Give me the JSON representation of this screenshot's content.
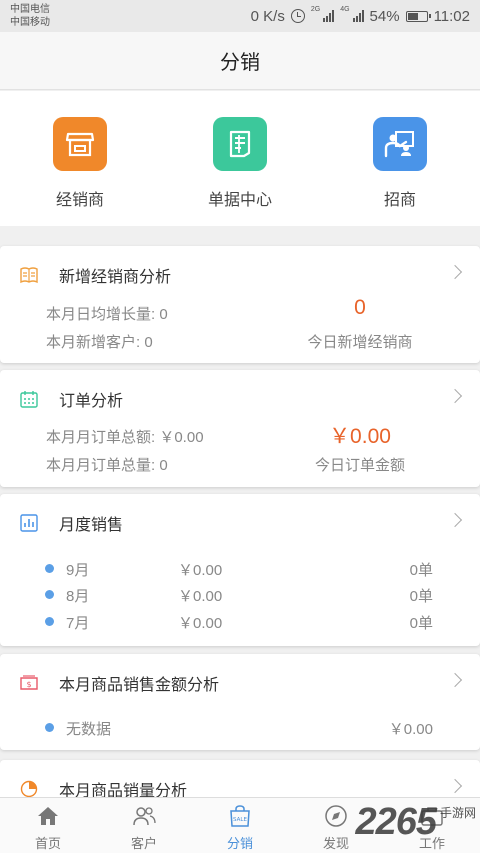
{
  "status_bar": {
    "carrier_1": "中国电信",
    "carrier_2": "中国移动",
    "net_speed": "0 K/s",
    "signal_tag_1": "2G",
    "signal_tag_2": "4G",
    "battery": "54%",
    "time": "11:02"
  },
  "header": {
    "title": "分销"
  },
  "quick_actions": [
    {
      "label": "经销商",
      "icon": "store-icon",
      "color": "#f0882a"
    },
    {
      "label": "单据中心",
      "icon": "receipt-icon",
      "color": "#3cc89b"
    },
    {
      "label": "招商",
      "icon": "recruit-icon",
      "color": "#4a94e8"
    }
  ],
  "cards": {
    "dealer": {
      "title": "新增经销商分析",
      "avg_label": "本月日均增长量: 0",
      "new_clients_label": "本月新增客户: 0",
      "today_value": "0",
      "today_caption": "今日新增经销商"
    },
    "orders": {
      "title": "订单分析",
      "amount_label": "本月月订单总额: ￥0.00",
      "count_label": "本月月订单总量: 0",
      "today_value": "￥0.00",
      "today_caption": "今日订单金额"
    },
    "monthly": {
      "title": "月度销售",
      "rows": [
        {
          "month": "9月",
          "amount": "￥0.00",
          "orders": "0单"
        },
        {
          "month": "8月",
          "amount": "￥0.00",
          "orders": "0单"
        },
        {
          "month": "7月",
          "amount": "￥0.00",
          "orders": "0单"
        }
      ]
    },
    "product_amount": {
      "title": "本月商品销售金额分析",
      "row_label": "无数据",
      "row_value": "￥0.00"
    },
    "product_volume": {
      "title": "本月商品销量分析"
    }
  },
  "tabbar": {
    "items": [
      {
        "label": "首页",
        "icon": "home-icon"
      },
      {
        "label": "客户",
        "icon": "users-icon"
      },
      {
        "label": "分销",
        "icon": "sale-bag-icon",
        "active": true
      },
      {
        "label": "发现",
        "icon": "discover-icon"
      },
      {
        "label": "工作",
        "icon": "work-icon"
      }
    ],
    "active_color": "#4a90d9"
  },
  "watermark": {
    "number": "2265",
    "text": "手游网"
  }
}
